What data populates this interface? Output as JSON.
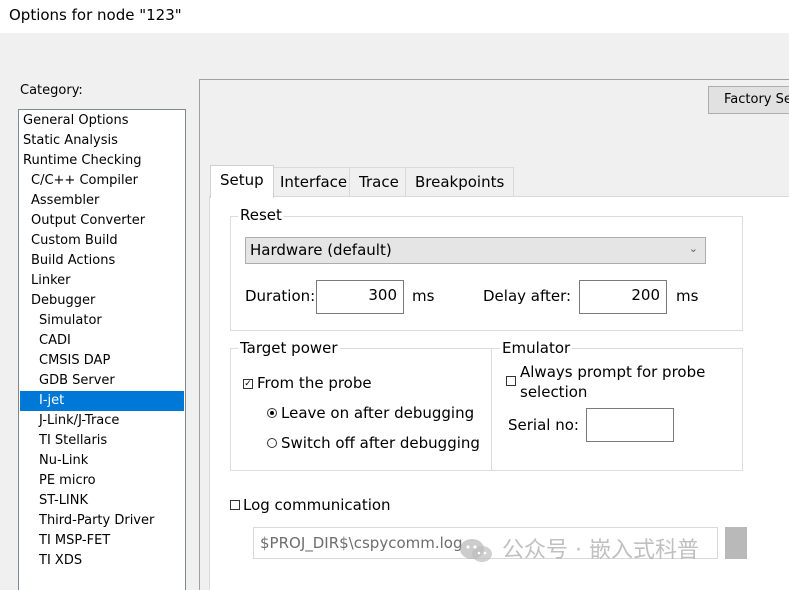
{
  "window": {
    "title": "Options for node \"123\""
  },
  "category": {
    "label": "Category:",
    "items": [
      {
        "label": "General Options",
        "level": 0
      },
      {
        "label": "Static Analysis",
        "level": 0
      },
      {
        "label": "Runtime Checking",
        "level": 0
      },
      {
        "label": "C/C++ Compiler",
        "level": 1
      },
      {
        "label": "Assembler",
        "level": 1
      },
      {
        "label": "Output Converter",
        "level": 1
      },
      {
        "label": "Custom Build",
        "level": 1
      },
      {
        "label": "Build Actions",
        "level": 1
      },
      {
        "label": "Linker",
        "level": 1
      },
      {
        "label": "Debugger",
        "level": 1
      },
      {
        "label": "Simulator",
        "level": 2
      },
      {
        "label": "CADI",
        "level": 2
      },
      {
        "label": "CMSIS DAP",
        "level": 2
      },
      {
        "label": "GDB Server",
        "level": 2
      },
      {
        "label": "I-jet",
        "level": 2,
        "selected": true
      },
      {
        "label": "J-Link/J-Trace",
        "level": 2
      },
      {
        "label": "TI Stellaris",
        "level": 2
      },
      {
        "label": "Nu-Link",
        "level": 2
      },
      {
        "label": "PE micro",
        "level": 2
      },
      {
        "label": "ST-LINK",
        "level": 2
      },
      {
        "label": "Third-Party Driver",
        "level": 2
      },
      {
        "label": "TI MSP-FET",
        "level": 2
      },
      {
        "label": "TI XDS",
        "level": 2
      }
    ]
  },
  "factory_button": "Factory Se",
  "tabs": [
    {
      "label": "Setup",
      "active": true
    },
    {
      "label": "Interface"
    },
    {
      "label": "Trace"
    },
    {
      "label": "Breakpoints"
    }
  ],
  "reset": {
    "title": "Reset",
    "mode": "Hardware (default)",
    "duration_label": "Duration:",
    "duration_value": "300",
    "duration_unit": "ms",
    "delay_label": "Delay after:",
    "delay_value": "200",
    "delay_unit": "ms"
  },
  "target_power": {
    "title": "Target power",
    "from_probe": "From the probe",
    "from_probe_checked": true,
    "leave_on": "Leave on after debugging",
    "switch_off": "Switch off after debugging",
    "selected": "leave_on"
  },
  "emulator": {
    "title": "Emulator",
    "always_prompt_line1": "Always prompt for probe",
    "always_prompt_line2": "selection",
    "always_prompt_checked": false,
    "serial_label": "Serial no:",
    "serial_value": ""
  },
  "log": {
    "label": "Log communication",
    "checked": false,
    "path": "$PROJ_DIR$\\cspycomm.log"
  },
  "watermark": {
    "text": "公众号 · 嵌入式科普"
  },
  "colors": {
    "selection": "#0078d7",
    "dialog_bg": "#f0f0f0"
  }
}
